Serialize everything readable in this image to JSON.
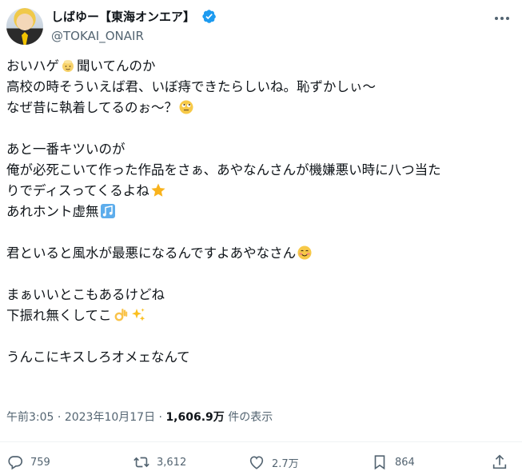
{
  "author": {
    "display_name": "しばゆー【東海オンエア】",
    "handle": "@TOKAI_ONAIR"
  },
  "tweet": {
    "lines": [
      "おいハゲ",
      "聞いてんのか",
      "高校の時そういえば君、いぼ痔できたらしいね。恥ずかしぃ～",
      "なぜ昔に執着してるのぉ～？",
      "あと一番キツいのが",
      "俺が必死こいて作った作品をさぁ、あやなんさんが機嫌悪い時に八つ当た",
      "りでディスってくるよね",
      "あれホント虚無",
      "君といると風水が最悪になるんですよあやなさん",
      "まぁいいとこもあるけどね",
      "下振れ無くしてこ",
      "うんこにキスしろオメェなんて"
    ]
  },
  "meta": {
    "time": "午前3:05",
    "separator": " · ",
    "date": "2023年10月17日",
    "views": "1,606.9万",
    "views_label": " 件の表示"
  },
  "actions": {
    "reply_count": "759",
    "retweet_count": "3,612",
    "like_count": "2.7万",
    "bookmark_count": "864"
  },
  "icons": {
    "verified": "verified-badge-icon",
    "more": "more-options-icon",
    "reply": "reply-icon",
    "retweet": "retweet-icon",
    "like": "heart-icon",
    "bookmark": "bookmark-icon",
    "share": "share-icon"
  },
  "colors": {
    "text": "#0f1419",
    "secondary": "#536471",
    "verified_blue": "#1d9bf0"
  }
}
